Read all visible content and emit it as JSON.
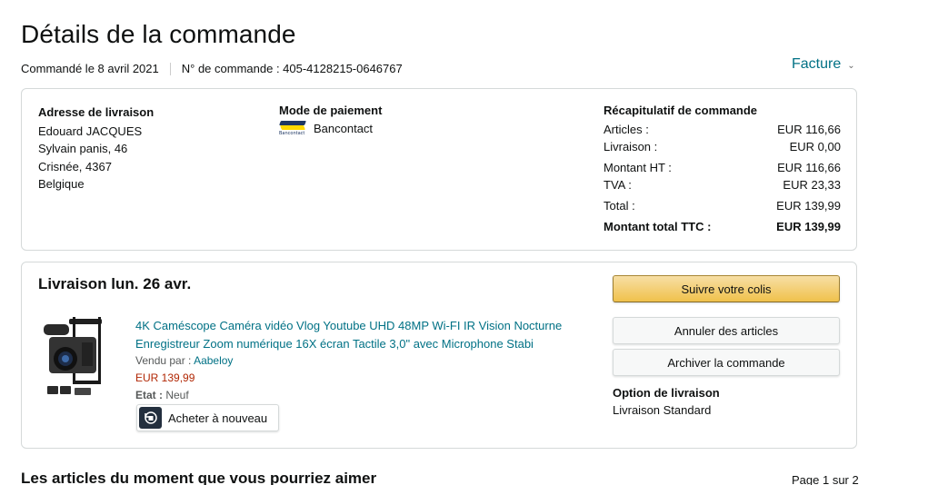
{
  "header": {
    "title": "Détails de la commande",
    "ordered_on": "Commandé le 8 avril 2021",
    "order_number": "N° de commande : 405-4128215-0646767",
    "invoice_label": "Facture"
  },
  "address": {
    "title": "Adresse de livraison",
    "lines": [
      "Edouard JACQUES",
      "Sylvain panis, 46",
      "Crisnée, 4367",
      "Belgique"
    ]
  },
  "payment": {
    "title": "Mode de paiement",
    "method": "Bancontact",
    "logo_text": "Bancontact"
  },
  "summary": {
    "title": "Récapitulatif de commande",
    "rows": [
      {
        "label": "Articles :",
        "value": "EUR 116,66"
      },
      {
        "label": "Livraison :",
        "value": "EUR 0,00"
      },
      {
        "label": "Montant HT :",
        "value": "EUR 116,66"
      },
      {
        "label": "TVA :",
        "value": "EUR 23,33"
      },
      {
        "label": "Total :",
        "value": "EUR 139,99"
      },
      {
        "label": "Montant total TTC :",
        "value": "EUR 139,99"
      }
    ]
  },
  "delivery": {
    "title": "Livraison lun. 26 avr.",
    "product": {
      "name_line1": "4K Caméscope Caméra vidéo Vlog Youtube UHD 48MP Wi-FI IR Vision Nocturne",
      "name_line2": "Enregistreur Zoom numérique 16X écran Tactile 3,0\" avec Microphone Stabi",
      "sold_by_label": "Vendu par :",
      "seller": "Aabeloy",
      "price": "EUR 139,99",
      "condition_label": "Etat :",
      "condition": "Neuf"
    },
    "buy_again_label": "Acheter à nouveau",
    "buttons": {
      "track": "Suivre votre colis",
      "cancel": "Annuler des articles",
      "archive": "Archiver la commande"
    },
    "shipping_option_title": "Option de livraison",
    "shipping_option_value": "Livraison Standard"
  },
  "recommendations": {
    "title": "Les articles du moment que vous pourriez aimer",
    "pager": "Page 1 sur 2"
  },
  "colors": {
    "link": "#007185",
    "price": "#b12704",
    "primary_button": "#f0c14b",
    "border": "#d5d9d9"
  }
}
